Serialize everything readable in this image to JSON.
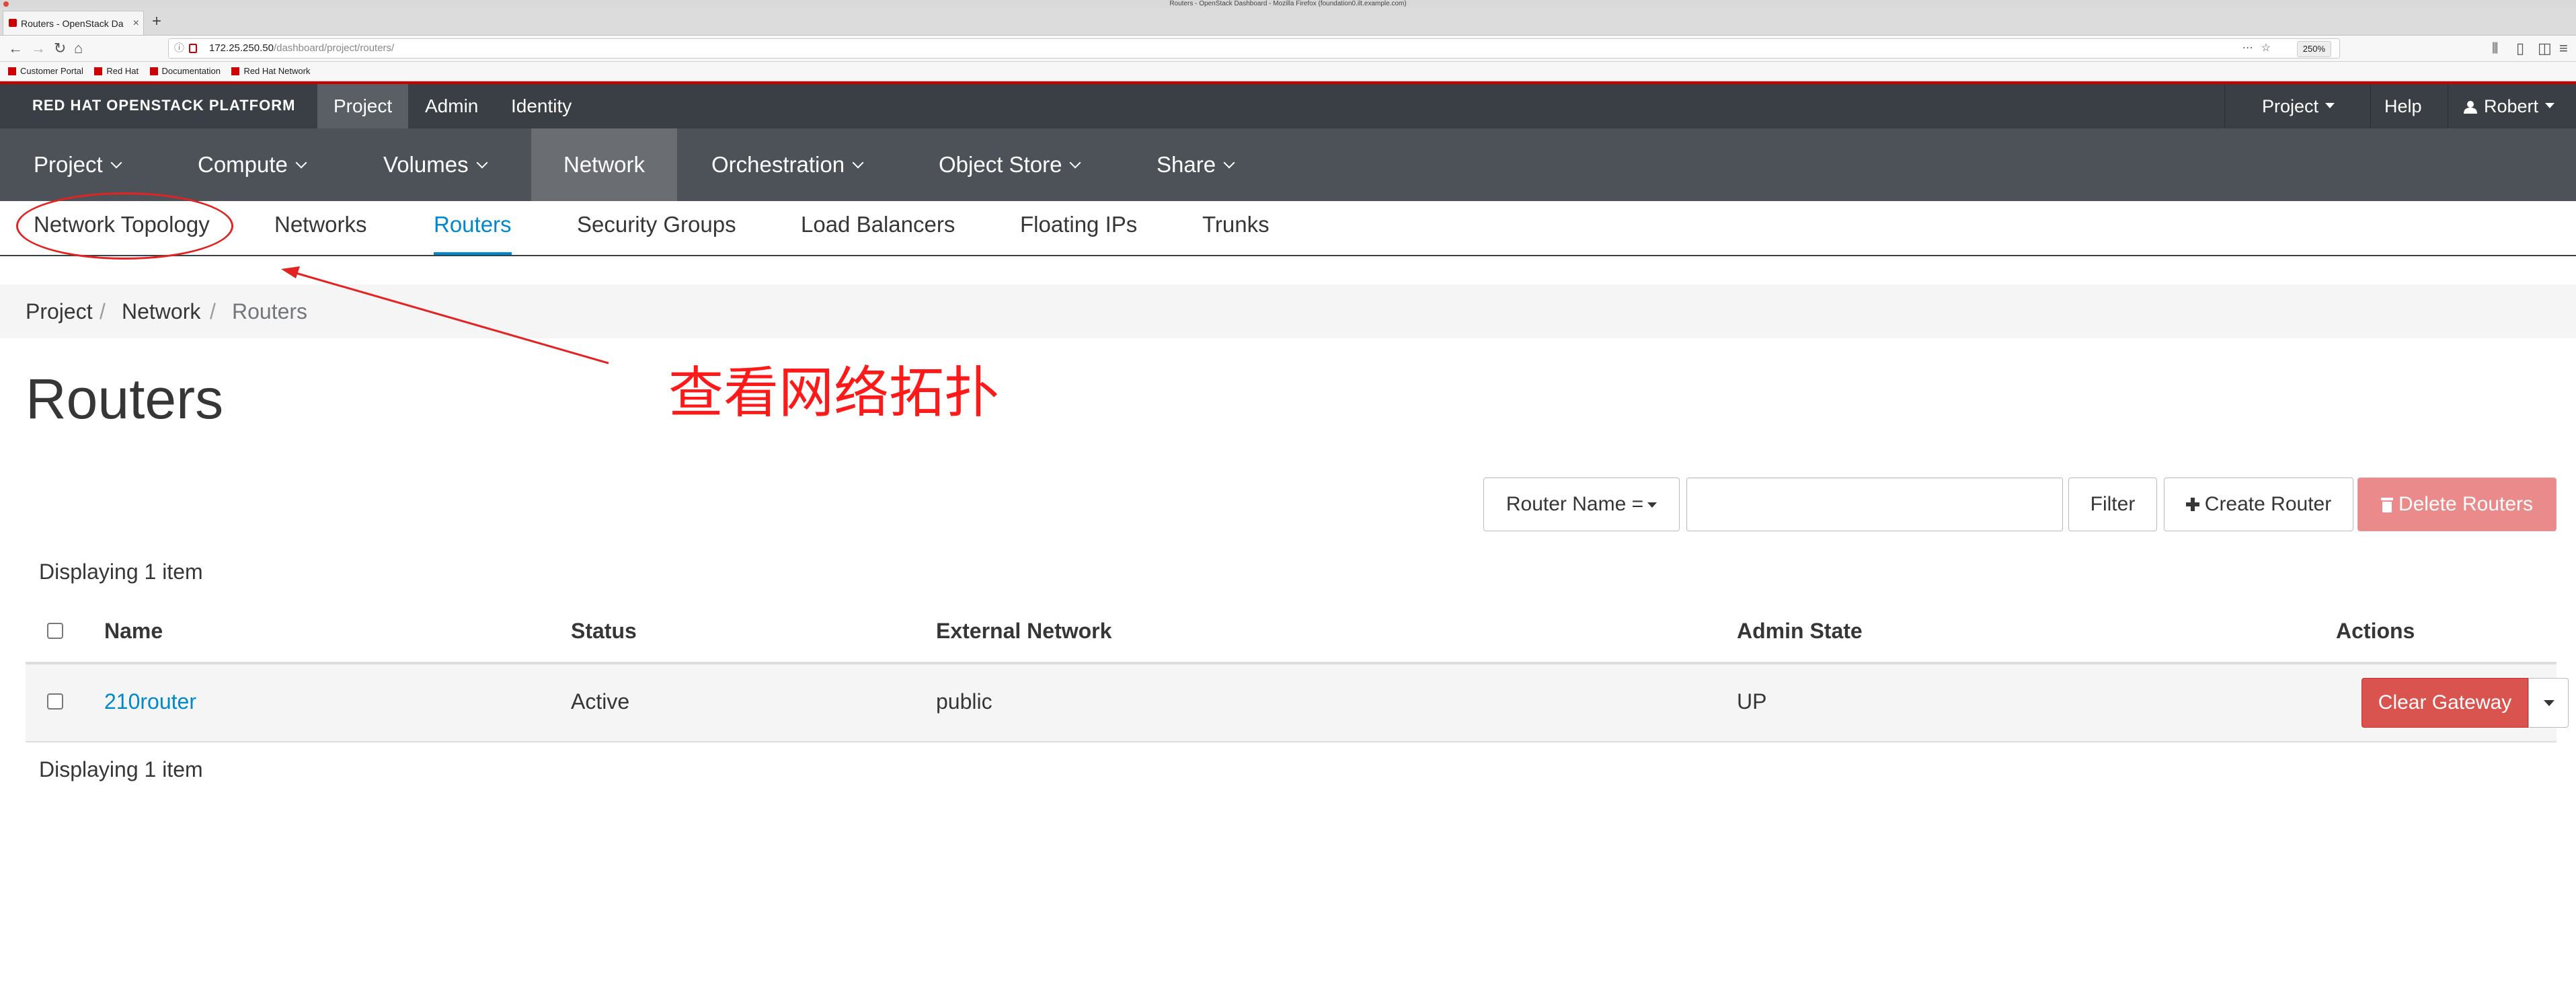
{
  "browser": {
    "window_title": "Routers - OpenStack Dashboard - Mozilla Firefox (foundation0.ilt.example.com)",
    "tab_title": "Routers - OpenStack Da",
    "url_host": "172.25.250.50",
    "url_path": "/dashboard/project/routers/",
    "zoom": "250%",
    "bookmarks": [
      "Customer Portal",
      "Red Hat",
      "Documentation",
      "Red Hat Network"
    ]
  },
  "header": {
    "brand": "RED HAT OPENSTACK PLATFORM",
    "top_tabs": [
      "Project",
      "Admin",
      "Identity"
    ],
    "right": {
      "project_menu": "Project",
      "help": "Help",
      "user": "Robert"
    }
  },
  "primary_nav": [
    "Project",
    "Compute",
    "Volumes",
    "Network",
    "Orchestration",
    "Object Store",
    "Share"
  ],
  "secondary_nav": [
    "Network Topology",
    "Networks",
    "Routers",
    "Security Groups",
    "Load Balancers",
    "Floating IPs",
    "Trunks"
  ],
  "breadcrumb": [
    "Project",
    "Network",
    "Routers"
  ],
  "page_title": "Routers",
  "annotation": {
    "text": "查看网络拓扑",
    "color": "#ff1a1a"
  },
  "toolbar": {
    "filter_field": "Router Name =",
    "filter_value": "",
    "filter_button": "Filter",
    "create_button": "Create Router",
    "delete_button": "Delete Routers"
  },
  "table": {
    "count_text": "Displaying 1 item",
    "columns": [
      "Name",
      "Status",
      "External Network",
      "Admin State",
      "Actions"
    ],
    "rows": [
      {
        "name": "210router",
        "status": "Active",
        "external_network": "public",
        "admin_state": "UP",
        "action": "Clear Gateway"
      }
    ]
  },
  "colors": {
    "brand_red": "#cc0000",
    "link_blue": "#0088ce",
    "danger_red": "#d9534f",
    "nav_dark": "#393f44"
  }
}
